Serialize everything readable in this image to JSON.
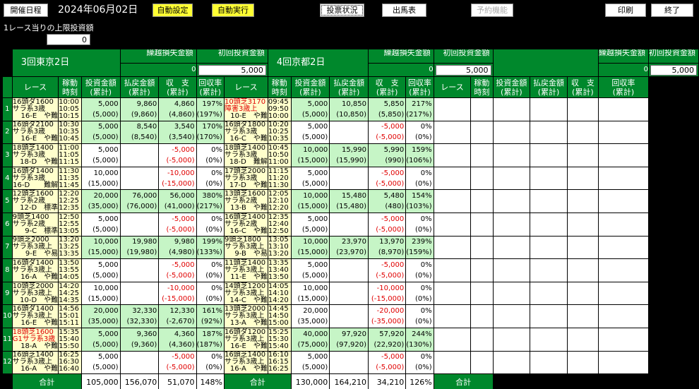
{
  "toolbar": {
    "schedule": "開催日程",
    "date": "2024年06月02日",
    "auto_setting": "自動設定",
    "auto_run": "自動実行",
    "vote_status": "投票状況",
    "entries": "出馬表",
    "reservation": "予約機能",
    "print": "印刷",
    "exit": "終了"
  },
  "limit": {
    "label": "1レース当りの上限投資額",
    "value": "0"
  },
  "labels": {
    "loss": "繰越損失金額",
    "initial": "初回投資金額",
    "total": "合計",
    "col_race": "レース",
    "col_time": [
      "稼動",
      "時刻"
    ],
    "col_invest": [
      "投資金額",
      "(累計)"
    ],
    "col_payout": [
      "払戻金額",
      "(累計)"
    ],
    "col_balance": [
      "収　支",
      "(累計)"
    ],
    "col_rate": [
      "回収率",
      "(累計)"
    ]
  },
  "venues": [
    {
      "name": "3回東京2日",
      "loss": "0",
      "initial": "5,000",
      "races": [
        {
          "info": [
            "16頭ダ1600",
            "サラ系3歳",
            "16-E　や難"
          ],
          "red": false,
          "times": [
            "10:00",
            "10:05",
            "10:15"
          ],
          "inv": [
            "5,000",
            "(5,000)"
          ],
          "pay": [
            "9,860",
            "(9,860)"
          ],
          "bal": [
            "4,860",
            "(4,860)"
          ],
          "rate": [
            "197%",
            "(197%)"
          ],
          "win": true
        },
        {
          "info": [
            "16頭ダ2100",
            "サラ系3歳",
            "16-E　や難"
          ],
          "red": false,
          "times": [
            "10:30",
            "10:35",
            "10:45"
          ],
          "inv": [
            "5,000",
            "(5,000)"
          ],
          "pay": [
            "8,540",
            "(8,540)"
          ],
          "bal": [
            "3,540",
            "(3,540)"
          ],
          "rate": [
            "170%",
            "(170%)"
          ],
          "win": true
        },
        {
          "info": [
            "18頭芝1400",
            "サラ系3歳",
            "18-D　や難"
          ],
          "red": false,
          "times": [
            "11:00",
            "11:05",
            "11:15"
          ],
          "inv": [
            "5,000",
            "(5,000)"
          ],
          "pay": [
            "",
            ""
          ],
          "bal": [
            "-5,000",
            "(-5,000)"
          ],
          "rate": [
            "0%",
            "(0%)"
          ],
          "win": false
        },
        {
          "info": [
            "16頭ダ1400",
            "サラ系3歳",
            "16-D　　難解"
          ],
          "red": false,
          "times": [
            "11:30",
            "11:35",
            "11:45"
          ],
          "inv": [
            "10,000",
            "(15,000)"
          ],
          "pay": [
            "",
            ""
          ],
          "bal": [
            "-10,000",
            "(-15,000)"
          ],
          "rate": [
            "0%",
            "(0%)"
          ],
          "win": false
        },
        {
          "info": [
            "12頭芝1600",
            "サラ系2歳",
            "12-D　標準"
          ],
          "red": false,
          "times": [
            "12:20",
            "12:25",
            "12:35"
          ],
          "inv": [
            "20,000",
            "(35,000)"
          ],
          "pay": [
            "76,000",
            "(76,000)"
          ],
          "bal": [
            "56,000",
            "(41,000)"
          ],
          "rate": [
            "380%",
            "(217%)"
          ],
          "win": true
        },
        {
          "info": [
            "9頭芝1400",
            "サラ系2歳",
            "9-C　標準"
          ],
          "red": false,
          "times": [
            "12:50",
            "12:55",
            "13:05"
          ],
          "inv": [
            "5,000",
            "(5,000)"
          ],
          "pay": [
            "",
            ""
          ],
          "bal": [
            "-5,000",
            "(-5,000)"
          ],
          "rate": [
            "0%",
            "(0%)"
          ],
          "win": false
        },
        {
          "info": [
            "9頭芝2000",
            "サラ系3歳上",
            "9-E　や易"
          ],
          "red": false,
          "times": [
            "13:20",
            "13:25",
            "13:35"
          ],
          "inv": [
            "10,000",
            "(15,000)"
          ],
          "pay": [
            "19,980",
            "(19,980)"
          ],
          "bal": [
            "9,980",
            "(4,980)"
          ],
          "rate": [
            "199%",
            "(133%)"
          ],
          "win": true
        },
        {
          "info": [
            "16頭ダ1400",
            "サラ系3歳上",
            "16-A　や難"
          ],
          "red": false,
          "times": [
            "13:50",
            "13:55",
            "14:05"
          ],
          "inv": [
            "5,000",
            "(5,000)"
          ],
          "pay": [
            "",
            ""
          ],
          "bal": [
            "-5,000",
            "(-5,000)"
          ],
          "rate": [
            "0%",
            "(0%)"
          ],
          "win": false
        },
        {
          "info": [
            "10頭芝2000",
            "サラ系3歳上",
            "10-D　や難"
          ],
          "red": false,
          "times": [
            "14:20",
            "14:25",
            "14:35"
          ],
          "inv": [
            "10,000",
            "(15,000)"
          ],
          "pay": [
            "",
            ""
          ],
          "bal": [
            "-10,000",
            "(-15,000)"
          ],
          "rate": [
            "0%",
            "(0%)"
          ],
          "win": false
        },
        {
          "info": [
            "16頭ダ1400",
            "サラ系3歳上",
            "16-E　や難"
          ],
          "red": false,
          "times": [
            "14:56",
            "15:01",
            "15:11"
          ],
          "inv": [
            "20,000",
            "(35,000)"
          ],
          "pay": [
            "32,330",
            "(32,330)"
          ],
          "bal": [
            "12,330",
            "(-2,670)"
          ],
          "rate": [
            "161%",
            "(92%)"
          ],
          "win": true
        },
        {
          "info": [
            "18頭芝1600",
            "G1サラ系3歳",
            "18-A　や難"
          ],
          "red": true,
          "times": [
            "15:35",
            "15:40",
            "15:50"
          ],
          "inv": [
            "5,000",
            "(5,000)"
          ],
          "pay": [
            "9,360",
            "(9,360)"
          ],
          "bal": [
            "4,360",
            "(4,360)"
          ],
          "rate": [
            "187%",
            "(187%)"
          ],
          "win": true
        },
        {
          "info": [
            "16頭芝1400",
            "サラ系3歳上",
            "16-A　や難"
          ],
          "red": false,
          "times": [
            "16:25",
            "16:30",
            "16:40"
          ],
          "inv": [
            "5,000",
            "(5,000)"
          ],
          "pay": [
            "",
            ""
          ],
          "bal": [
            "-5,000",
            "(-5,000)"
          ],
          "rate": [
            "0%",
            "(0%)"
          ],
          "win": false
        }
      ],
      "totals": {
        "inv": "105,000",
        "pay": "156,070",
        "bal": "51,070",
        "rate": "148%"
      }
    },
    {
      "name": "4回京都2日",
      "loss": "0",
      "initial": "5,000",
      "races": [
        {
          "info": [
            "10頭芝3170",
            "障害3歳上",
            "10-E　や難"
          ],
          "red": true,
          "times": [
            "09:45",
            "09:50",
            "10:00"
          ],
          "inv": [
            "5,000",
            "(5,000)"
          ],
          "pay": [
            "10,850",
            "(10,850)"
          ],
          "bal": [
            "5,850",
            "(5,850)"
          ],
          "rate": [
            "217%",
            "(217%)"
          ],
          "win": true
        },
        {
          "info": [
            "16頭ダ1800",
            "サラ系3歳",
            "16-C　や難"
          ],
          "red": false,
          "times": [
            "10:20",
            "10:25",
            "10:35"
          ],
          "inv": [
            "5,000",
            "(5,000)"
          ],
          "pay": [
            "",
            ""
          ],
          "bal": [
            "-5,000",
            "(-5,000)"
          ],
          "rate": [
            "0%",
            "(0%)"
          ],
          "win": false
        },
        {
          "info": [
            "18頭芝1400",
            "サラ系3歳",
            "18-D　難解"
          ],
          "red": false,
          "times": [
            "10:45",
            "10:50",
            "11:00"
          ],
          "inv": [
            "10,000",
            "(15,000)"
          ],
          "pay": [
            "15,990",
            "(15,990)"
          ],
          "bal": [
            "5,990",
            "(990)"
          ],
          "rate": [
            "159%",
            "(106%)"
          ],
          "win": true
        },
        {
          "info": [
            "17頭芝2000",
            "サラ系3歳",
            "17-D　や難"
          ],
          "red": false,
          "times": [
            "11:15",
            "11:20",
            "11:30"
          ],
          "inv": [
            "5,000",
            "(5,000)"
          ],
          "pay": [
            "",
            ""
          ],
          "bal": [
            "-5,000",
            "(-5,000)"
          ],
          "rate": [
            "0%",
            "(0%)"
          ],
          "win": false
        },
        {
          "info": [
            "13頭芝1600",
            "サラ系2歳",
            "13-B　や難"
          ],
          "red": false,
          "times": [
            "12:05",
            "12:10",
            "12:20"
          ],
          "inv": [
            "10,000",
            "(15,000)"
          ],
          "pay": [
            "15,480",
            "(15,480)"
          ],
          "bal": [
            "5,480",
            "(480)"
          ],
          "rate": [
            "154%",
            "(103%)"
          ],
          "win": true
        },
        {
          "info": [
            "16頭芝1400",
            "サラ系2歳",
            "16-C　や難"
          ],
          "red": false,
          "times": [
            "12:35",
            "12:40",
            "12:50"
          ],
          "inv": [
            "5,000",
            "(5,000)"
          ],
          "pay": [
            "",
            ""
          ],
          "bal": [
            "-5,000",
            "(-5,000)"
          ],
          "rate": [
            "0%",
            "(0%)"
          ],
          "win": false
        },
        {
          "info": [
            "9頭芝1800",
            "サラ系3歳上",
            "9-B　や易"
          ],
          "red": false,
          "times": [
            "13:05",
            "13:10",
            "13:20"
          ],
          "inv": [
            "10,000",
            "(15,000)"
          ],
          "pay": [
            "23,970",
            "(23,970)"
          ],
          "bal": [
            "13,970",
            "(8,970)"
          ],
          "rate": [
            "239%",
            "(159%)"
          ],
          "win": true
        },
        {
          "info": [
            "11頭芝1400",
            "サラ系3歳上",
            "11-E　や難"
          ],
          "red": false,
          "times": [
            "13:35",
            "13:40",
            "13:50"
          ],
          "inv": [
            "5,000",
            "(5,000)"
          ],
          "pay": [
            "",
            ""
          ],
          "bal": [
            "-5,000",
            "(-5,000)"
          ],
          "rate": [
            "0%",
            "(0%)"
          ],
          "win": false
        },
        {
          "info": [
            "14頭芝1200",
            "サラ系3歳上",
            "14-C　や難"
          ],
          "red": false,
          "times": [
            "14:05",
            "14:10",
            "14:20"
          ],
          "inv": [
            "10,000",
            "(15,000)"
          ],
          "pay": [
            "",
            ""
          ],
          "bal": [
            "-10,000",
            "(-15,000)"
          ],
          "rate": [
            "0%",
            "(0%)"
          ],
          "win": false
        },
        {
          "info": [
            "13頭芝2000",
            "サラ系3歳上",
            "13-A　や難"
          ],
          "red": false,
          "times": [
            "14:45",
            "14:50",
            "15:00"
          ],
          "inv": [
            "20,000",
            "(35,000)"
          ],
          "pay": [
            "",
            ""
          ],
          "bal": [
            "-20,000",
            "(-35,000)"
          ],
          "rate": [
            "0%",
            "(0%)"
          ],
          "win": false
        },
        {
          "info": [
            "16頭ダ1200",
            "サラ系3歳上",
            "16-E　や難"
          ],
          "red": false,
          "times": [
            "15:25",
            "15:30",
            "15:40"
          ],
          "inv": [
            "40,000",
            "(75,000)"
          ],
          "pay": [
            "97,920",
            "(97,920)"
          ],
          "bal": [
            "57,920",
            "(22,920)"
          ],
          "rate": [
            "244%",
            "(130%)"
          ],
          "win": true
        },
        {
          "info": [
            "16頭芝1400",
            "サラ系3歳上",
            "16-A　や難"
          ],
          "red": false,
          "times": [
            "16:10",
            "16:15",
            "16:25"
          ],
          "inv": [
            "5,000",
            "(5,000)"
          ],
          "pay": [
            "",
            ""
          ],
          "bal": [
            "-5,000",
            "(-5,000)"
          ],
          "rate": [
            "0%",
            "(0%)"
          ],
          "win": false
        }
      ],
      "totals": {
        "inv": "130,000",
        "pay": "164,210",
        "bal": "34,210",
        "rate": "126%"
      }
    },
    {
      "name": "",
      "loss": "0",
      "initial": "5,000",
      "races": [],
      "totals": {
        "inv": "",
        "pay": "",
        "bal": "",
        "rate": ""
      }
    }
  ]
}
